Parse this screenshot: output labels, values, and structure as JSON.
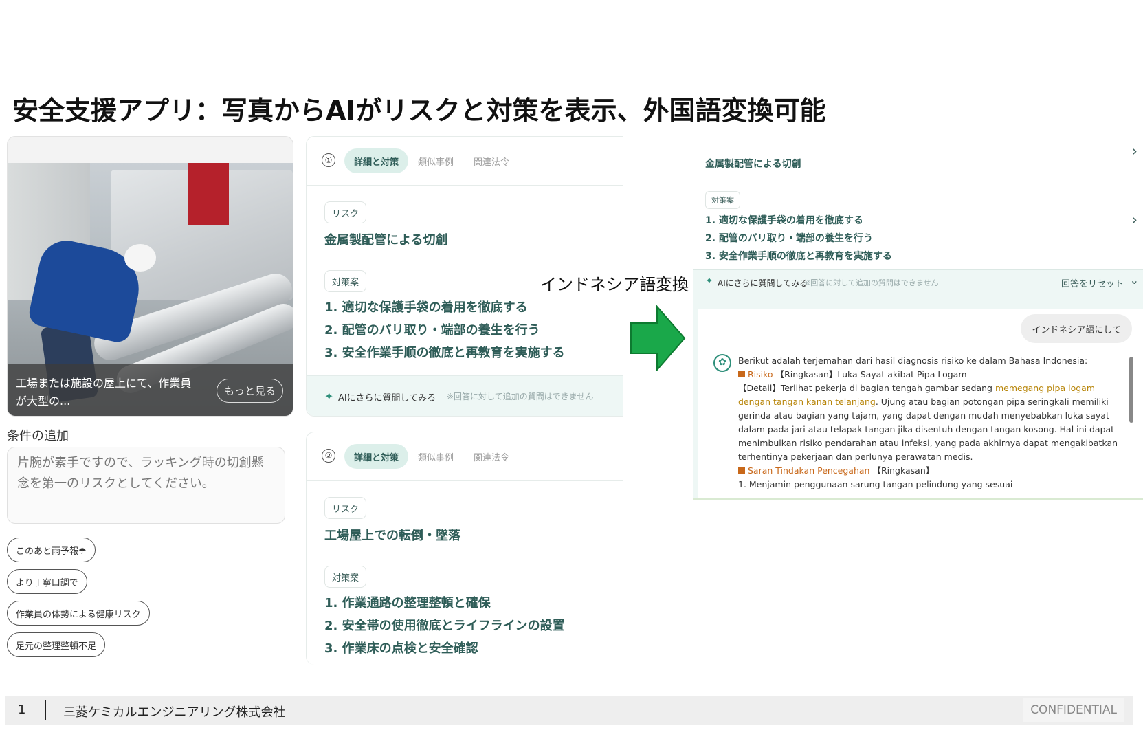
{
  "slide": {
    "title": "安全支援アプリ：写真からAIがリスクと対策を表示、外国語変換可能",
    "convert_label": "インドネシア語変換"
  },
  "photo_card": {
    "caption": "工場または施設の屋上にて、作業員が大型の...",
    "more_label": "もっと見る"
  },
  "conditions": {
    "label": "条件の追加",
    "input_value": "片腕が素手ですので、ラッキング時の切創懸念を第一のリスクとしてください。",
    "chips": [
      "このあと雨予報☂",
      "より丁寧口調で",
      "作業員の体勢による健康リスク",
      "足元の整理整頓不足"
    ]
  },
  "cards": [
    {
      "num": "①",
      "tabs": [
        "詳細と対策",
        "類似事例",
        "関連法令"
      ],
      "risk_badge": "リスク",
      "risk": "金属製配管による切創",
      "measure_badge": "対策案",
      "measures": [
        "1. 適切な保護手袋の着用を徹底する",
        "2. 配管のバリ取り・端部の養生を行う",
        "3. 安全作業手順の徹底と再教育を実施する"
      ],
      "ask_label": "AIにさらに質問してみる",
      "ask_note": "※回答に対して追加の質問はできません"
    },
    {
      "num": "②",
      "tabs": [
        "詳細と対策",
        "類似事例",
        "関連法令"
      ],
      "risk_badge": "リスク",
      "risk": "工場屋上での転倒・墜落",
      "measure_badge": "対策案",
      "measures": [
        "1. 作業通路の整理整頓と確保",
        "2. 安全帯の使用徹底とライフラインの設置",
        "3. 作業床の点検と安全確認"
      ]
    }
  ],
  "right": {
    "risk": "金属製配管による切創",
    "measure_badge": "対策案",
    "measures": [
      "1. 適切な保護手袋の着用を徹底する",
      "2. 配管のバリ取り・端部の養生を行う",
      "3. 安全作業手順の徹底と再教育を実施する"
    ],
    "ask_label": "AIにさらに質問してみる",
    "ask_note": "※回答に対して追加の質問はできません",
    "reset_label": "回答をリセット",
    "user_message": "インドネシア語にして",
    "bot": {
      "intro": "Berikut adalah terjemahan dari hasil diagnosis risiko ke dalam Bahasa Indonesia:",
      "risk_heading": "Risiko",
      "risk_summary": "【Ringkasan】Luka Sayat akibat Pipa Logam",
      "detail_prefix": "【Detail】Terlihat pekerja di bagian tengah gambar sedang ",
      "detail_highlight": "memegang pipa logam dengan tangan kanan telanjang",
      "detail_rest": ". Ujung atau bagian potongan pipa seringkali memiliki gerinda atau bagian yang tajam, yang dapat dengan mudah menyebabkan luka sayat dalam pada jari atau telapak tangan jika disentuh dengan tangan kosong. Hal ini dapat menimbulkan risiko pendarahan atau infeksi, yang pada akhirnya dapat mengakibatkan terhentinya pekerjaan dan perlunya perawatan medis.",
      "saran_heading": "Saran Tindakan Pencegahan",
      "saran_summary": "【Ringkasan】",
      "saran_item1": "1. Menjamin penggunaan sarung tangan pelindung yang sesuai"
    }
  },
  "footer": {
    "page": "1",
    "company": "三菱ケミカルエンジニアリング株式会社",
    "confidential": "CONFIDENTIAL"
  },
  "colors": {
    "accent_green": "#2f5d58",
    "tab_bg": "#dcefea",
    "ask_bg": "#eef7f5",
    "arrow": "#1aa84a",
    "highlight": "#b8860b",
    "heading_orange": "#c8681a"
  }
}
